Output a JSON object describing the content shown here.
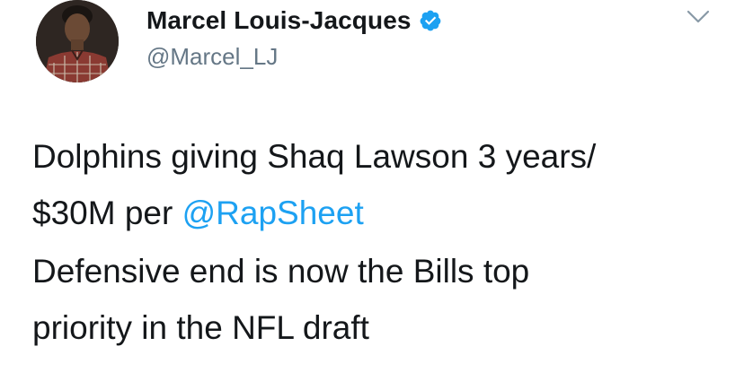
{
  "tweet": {
    "author": {
      "display_name": "Marcel Louis-Jacques",
      "handle": "@Marcel_LJ",
      "verified": true,
      "avatar": "profile-photo"
    },
    "menu_icon": "chevron-down-icon",
    "body": {
      "line1_a": "Dolphins giving Shaq Lawson 3 years/",
      "line2_a": "$30M per ",
      "mention": "@RapSheet",
      "paragraph2_line1": "Defensive end is now the Bills top",
      "paragraph2_line2": "priority in the NFL draft"
    }
  },
  "colors": {
    "text": "#14171a",
    "secondary": "#657786",
    "link": "#1da1f2",
    "verified_badge": "#1da1f2",
    "chevron": "#8899a6",
    "background": "#ffffff"
  }
}
